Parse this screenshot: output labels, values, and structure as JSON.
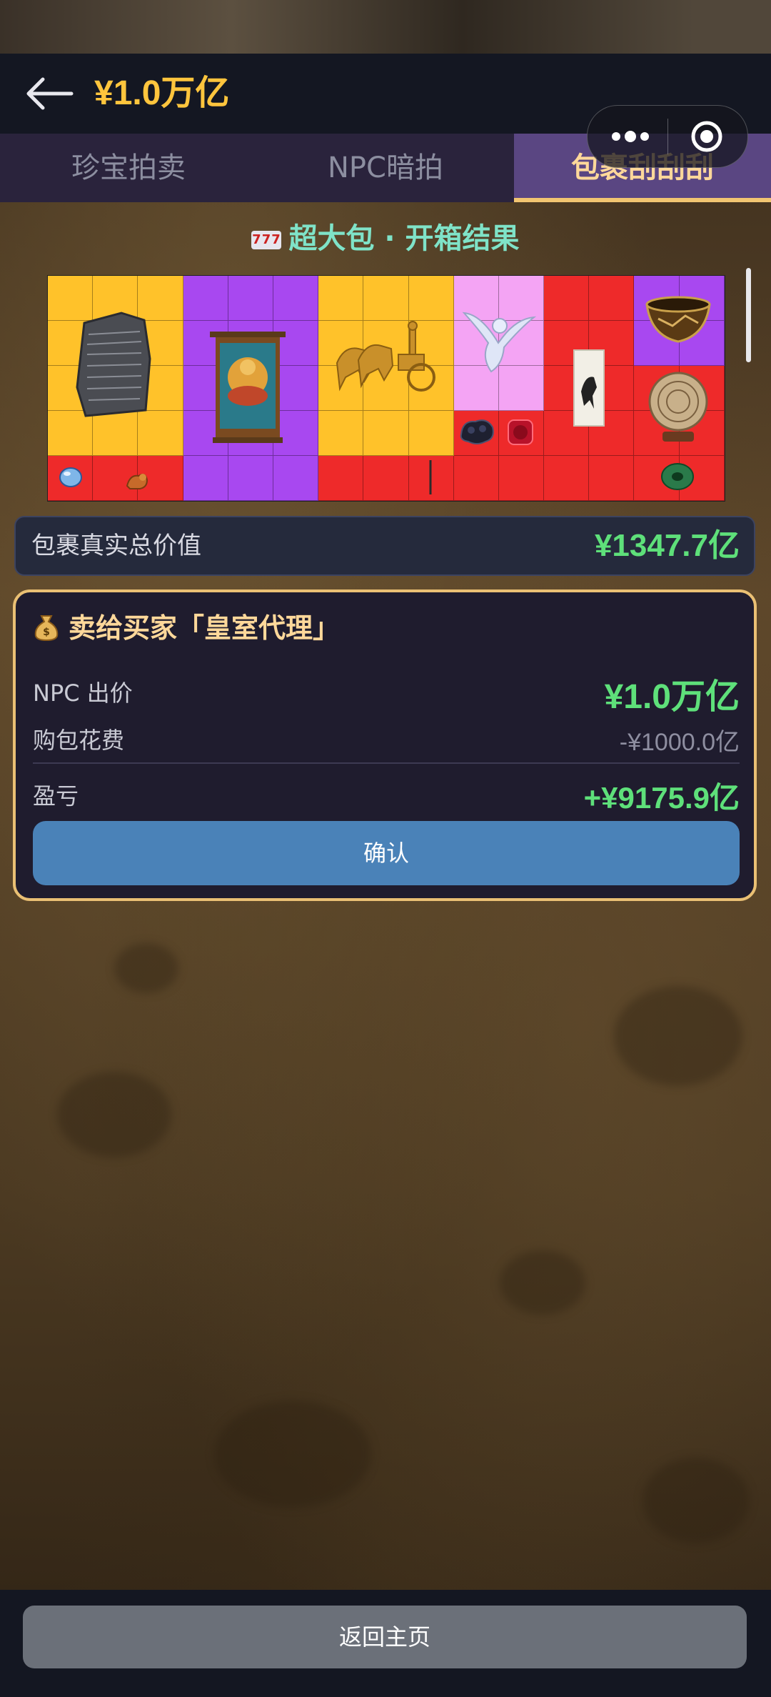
{
  "header": {
    "balance": "¥1.0万亿",
    "back_icon": "back-arrow-icon",
    "menu_icon": "more-dots-icon",
    "close_icon": "target-icon"
  },
  "tabs": [
    {
      "label": "珍宝拍卖",
      "active": false
    },
    {
      "label": "NPC暗拍",
      "active": false
    },
    {
      "label": "包裹刮刮刮",
      "active": true
    }
  ],
  "result": {
    "title": "超大包 · 开箱结果",
    "icon": "slot-machine-icon",
    "items": [
      "rosetta-stone",
      "thangka-painting",
      "golden-chariot",
      "porcelain-phoenix",
      "horse-scroll",
      "bronze-bowl",
      "carved-disk",
      "blue-gem",
      "jade-tiger",
      "black-dragon-figure",
      "red-seal",
      "hairpin",
      "jade-bi"
    ]
  },
  "value_bar": {
    "label": "包裹真实总价值",
    "amount": "¥1347.7亿"
  },
  "sell": {
    "title": "卖给买家「皇室代理」",
    "icon": "money-bag-icon",
    "npc_offer_label": "NPC 出价",
    "npc_offer_value": "¥1.0万亿",
    "cost_label": "购包花费",
    "cost_value": "-¥1000.0亿",
    "profit_label": "盈亏",
    "profit_value": "+¥9175.9亿",
    "confirm_label": "确认"
  },
  "footer": {
    "home_label": "返回主页"
  },
  "colors": {
    "gold": "#ffc53d",
    "green": "#5ee07a",
    "tab_active": "#5a4682",
    "confirm": "#4a82b8"
  }
}
